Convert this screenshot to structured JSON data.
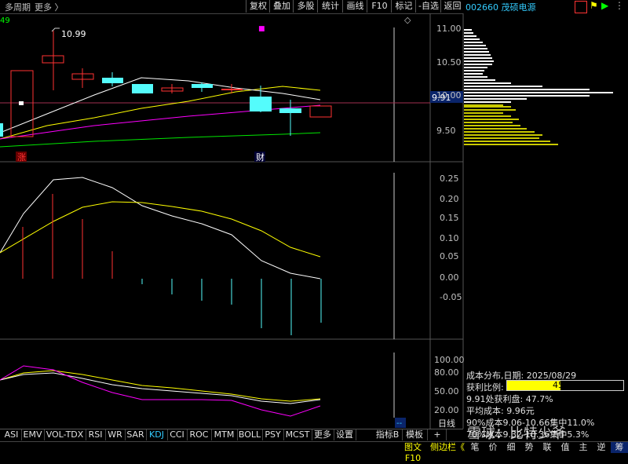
{
  "toolbar": {
    "period": "多周期",
    "more": "更多 〉",
    "buttons": [
      "复权",
      "叠加",
      "多股",
      "统计",
      "画线",
      "F10",
      "标记",
      "-自选",
      "返回"
    ]
  },
  "stock": {
    "code_name": "002660 茂硕电源"
  },
  "main_chart": {
    "price_axis": [
      "11.00",
      "10.50",
      "10.00",
      "9.50"
    ],
    "current_price_tag": "9.91",
    "high_annotation": "10.99",
    "left_number": "49",
    "badge_zhang": "涨",
    "badge_cai": "财"
  },
  "macd_axis": [
    "0.25",
    "0.20",
    "0.15",
    "0.10",
    "0.05",
    "0.00",
    "-0.05"
  ],
  "kdj_axis": [
    "100.00",
    "80.00",
    "50.00",
    "20.00"
  ],
  "info_panel": {
    "title": "成本分布,日期: 2025/08/29",
    "profit_label": "获利比例:",
    "profit_value": "45.9%",
    "profit_fraction": 0.459,
    "line2": "9.91处获利盘: 47.7%",
    "line3": "平均成本: 9.96元",
    "line4": "90%成本9.06-10.66集中11.0%",
    "line5": "70%成本9.32-10.36集中5.3%"
  },
  "tabs": [
    "ASI",
    "EMV",
    "VOL-TDX",
    "RSI",
    "WR",
    "SAR",
    "KDJ",
    "CCI",
    "ROC",
    "MTM",
    "BOLL",
    "PSY",
    "MCST",
    "更多",
    "设置"
  ],
  "active_tab": "KDJ",
  "right_tabs": [
    "指标B",
    "模板",
    "+"
  ],
  "day_label": "日线",
  "status_left": [
    "图文F10",
    "侧边栏《"
  ],
  "status_right": [
    "笔",
    "价",
    "细",
    "势",
    "联",
    "值",
    "主",
    "逆",
    "筹"
  ],
  "watermark": "雪球：比特少爷",
  "colors": {
    "up": "#ff3232",
    "down": "#54fcfc",
    "ma_yellow": "#ffff00",
    "ma_magenta": "#ff00ff",
    "ma_green": "#00e600",
    "ma_white": "#ffffff",
    "chip_yellow": "#c8c800"
  }
}
